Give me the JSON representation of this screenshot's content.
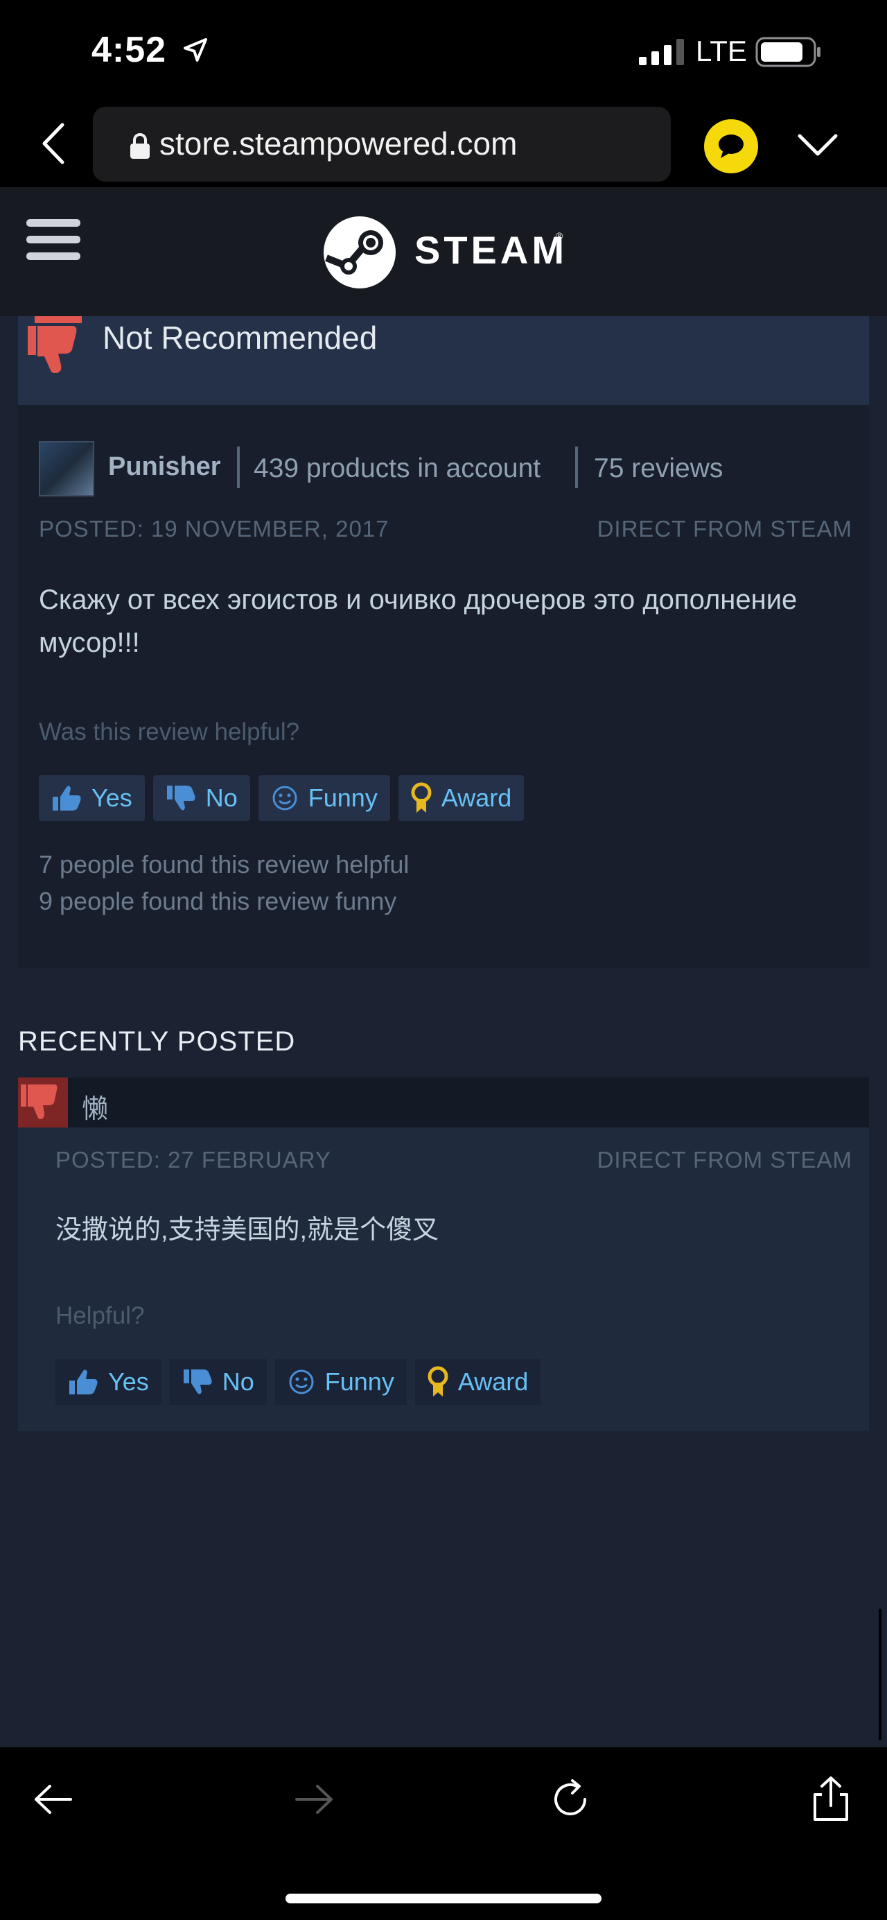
{
  "status_bar": {
    "time": "4:52",
    "network": "LTE"
  },
  "browser": {
    "url": "store.steampowered.com"
  },
  "header": {
    "logo_text": "STEAM",
    "registered": "®"
  },
  "review_main": {
    "verdict": "Not Recommended",
    "author": "Punisher",
    "products": "439 products in account",
    "reviews": "75 reviews",
    "posted": "POSTED: 19 NOVEMBER, 2017",
    "source": "DIRECT FROM STEAM",
    "body": "Скажу от всех эгоистов и очивко дрочеров это дополнение мусор!!!",
    "helpful_question": "Was this review helpful?",
    "buttons": {
      "yes": "Yes",
      "no": "No",
      "funny": "Funny",
      "award": "Award"
    },
    "found_helpful": "7 people found this review helpful",
    "found_funny": "9 people found this review funny"
  },
  "recently_posted": {
    "title": "RECENTLY POSTED",
    "review": {
      "author": "懒",
      "posted": "POSTED: 27 FEBRUARY",
      "source": "DIRECT FROM STEAM",
      "body": "没撒说的,支持美国的,就是个傻叉",
      "helpful_question": "Helpful?",
      "buttons": {
        "yes": "Yes",
        "no": "No",
        "funny": "Funny",
        "award": "Award"
      }
    }
  },
  "colors": {
    "accent": "#67c1f5",
    "thumb_down": "#d9534f",
    "award_gold": "#e8b820",
    "extension_yellow": "#f5d90a"
  }
}
